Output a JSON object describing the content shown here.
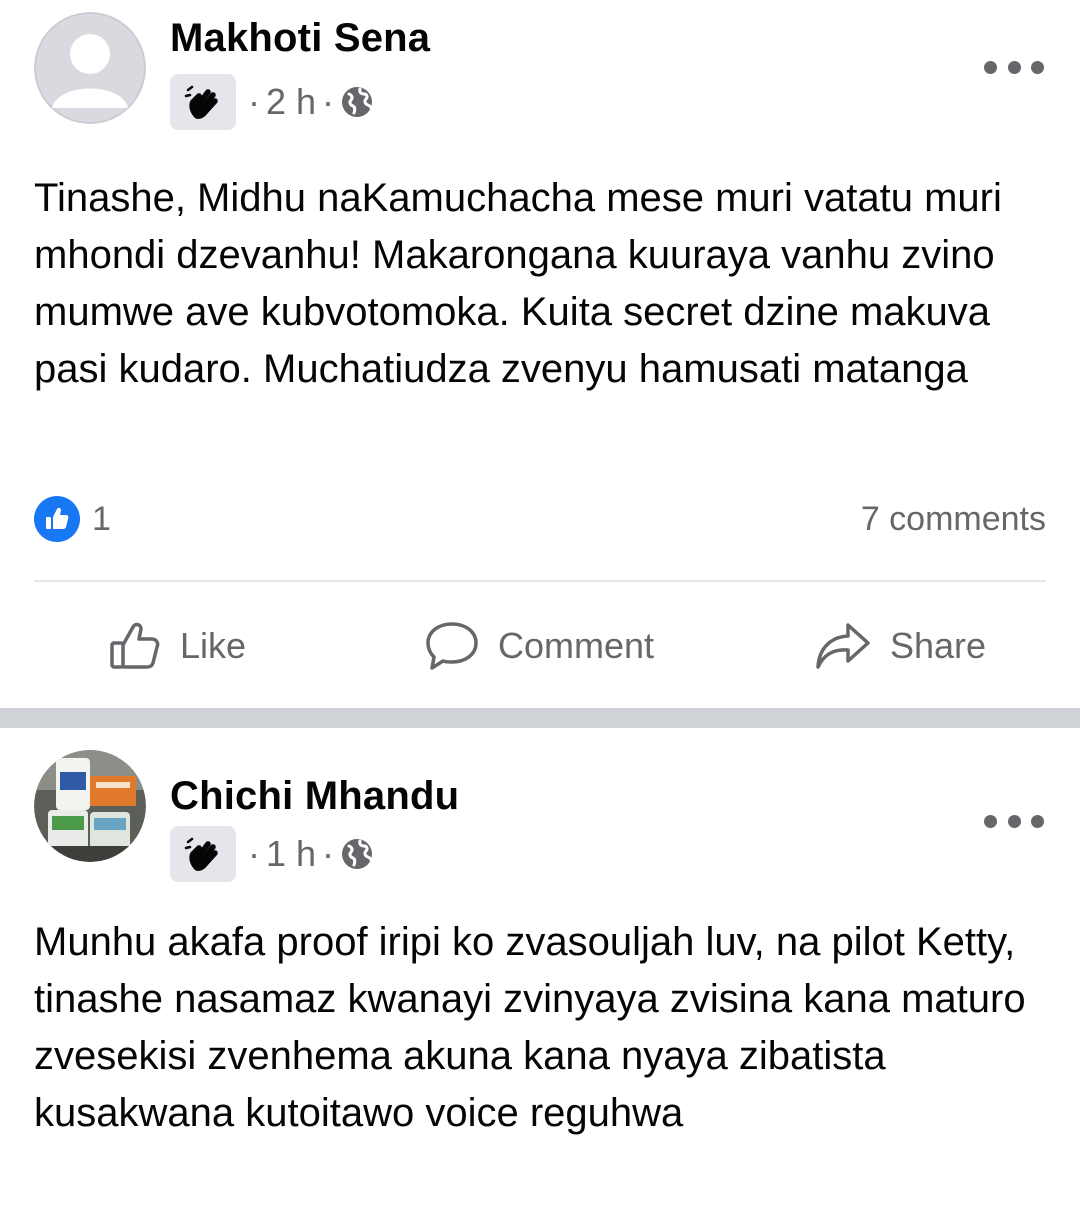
{
  "posts": [
    {
      "author": "Makhoti Sena",
      "time": "2 h",
      "separator": "·",
      "visibility_icon": "globe-icon",
      "badge_icon": "wave-icon",
      "text": "Tinashe, Midhu naKamuchacha mese muri vatatu muri mhondi dzevanhu! Makarongana kuuraya vanhu zvino mumwe ave kubvotomoka. Kuita secret dzine makuva pasi kudaro. Muchatiudza zvenyu hamusati matanga",
      "reaction_count": "1",
      "comments_label": "7 comments",
      "actions": {
        "like": "Like",
        "comment": "Comment",
        "share": "Share"
      }
    },
    {
      "author": "Chichi Mhandu",
      "time": "1 h",
      "separator": "·",
      "visibility_icon": "globe-icon",
      "badge_icon": "wave-icon",
      "text": "Munhu akafa proof iripi ko zvasouljah luv, na pilot Ketty, tinashe nasamaz kwanayi zvinyaya zvisina kana maturo zvesekisi zvenhema akuna kana nyaya zibatista kusakwana kutoitawo voice reguhwa"
    }
  ],
  "colors": {
    "accent": "#1877f2",
    "secondary_text": "#65676b",
    "divider": "#cfd3d8"
  }
}
